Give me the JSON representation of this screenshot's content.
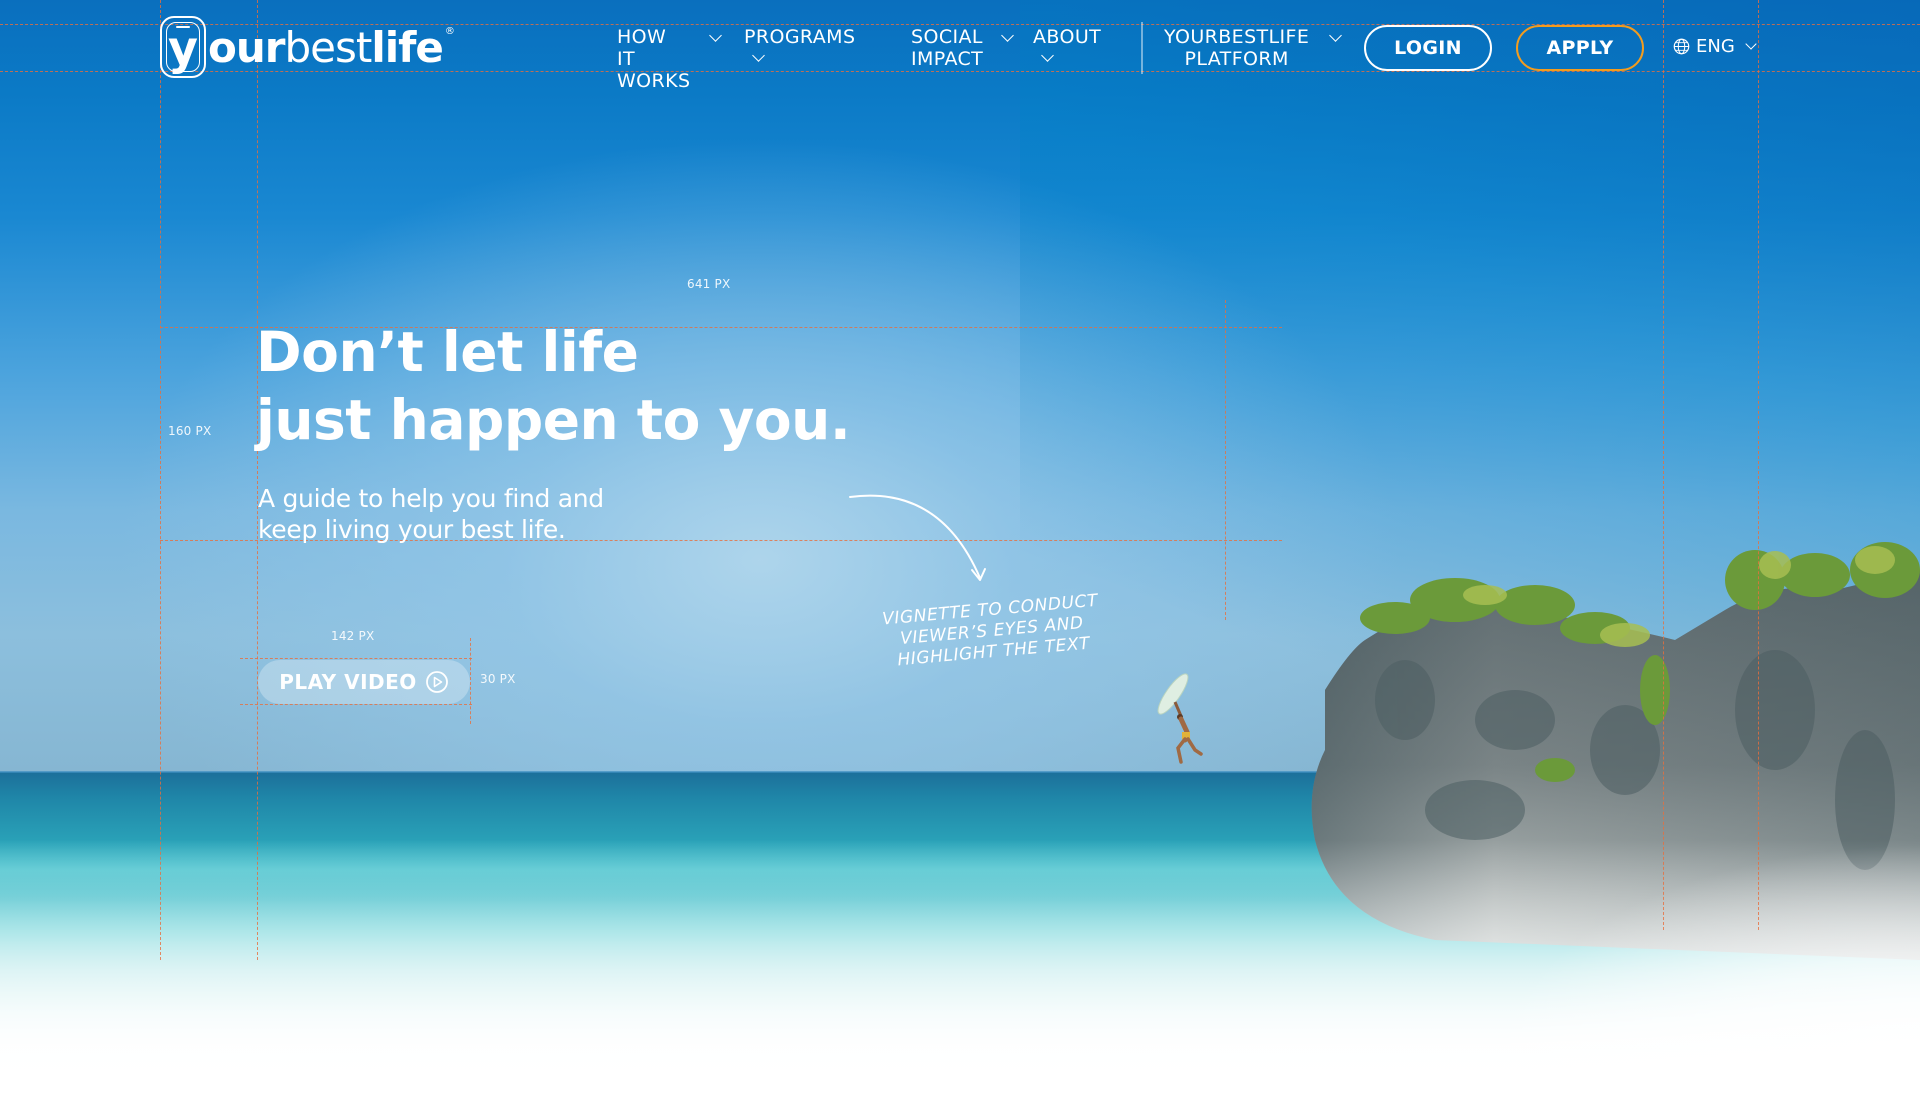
{
  "brand": {
    "logo_letter": "y",
    "logo_bold_1": "our",
    "logo_light": "best",
    "logo_bold_2": "life",
    "logo_reg": "®"
  },
  "nav": {
    "items": [
      {
        "label": "HOW IT\nWORKS",
        "icon": "chevron-down-icon"
      },
      {
        "label": "PROGRAMS",
        "icon": "chevron-down-icon"
      },
      {
        "label": "SOCIAL\nIMPACT",
        "icon": "chevron-down-icon"
      },
      {
        "label": "ABOUT",
        "icon": "chevron-down-icon"
      },
      {
        "label": "YOURBESTLIFE\nPLATFORM",
        "icon": "chevron-down-icon"
      }
    ],
    "login_label": "LOGIN",
    "apply_label": "APPLY",
    "language": {
      "label": "ENG",
      "icon": "globe-icon"
    }
  },
  "hero": {
    "title": "Don’t let life\njust happen to you.",
    "subtitle": "A guide to help you find and\nkeep living your best life.",
    "play_label": "PLAY VIDEO",
    "play_icon": "play-circle-icon"
  },
  "annotation": {
    "text": "VIGNETTE TO CONDUCT\nVIEWER’S EYES AND\nHIGHLIGHT THE TEXT",
    "icon": "curved-arrow-icon"
  },
  "guides": {
    "width_label": "641 PX",
    "height_label": "160 PX",
    "button_width_label": "142 PX",
    "button_height_label": "30 PX"
  },
  "colors": {
    "accent_orange": "#f39c1e",
    "sky_blue": "#0b7ac6",
    "guide_orange": "#e86e3c"
  }
}
